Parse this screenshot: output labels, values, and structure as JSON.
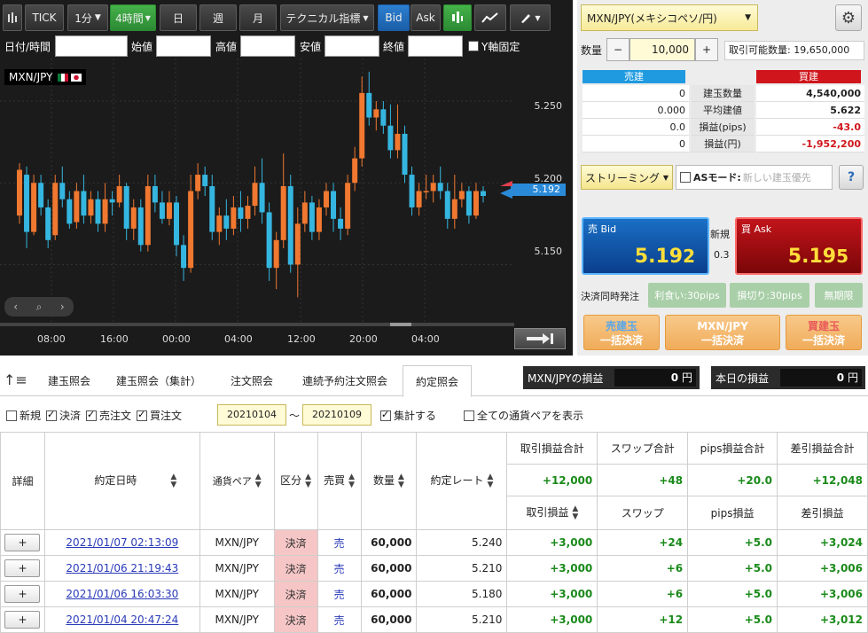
{
  "toolbar": {
    "tick": "TICK",
    "interval": "1分",
    "period": "4時間",
    "day": "日",
    "week": "週",
    "month": "月",
    "technical": "テクニカル指標",
    "bid": "Bid",
    "ask": "Ask"
  },
  "filter": {
    "datetime": "日付/時間",
    "open": "始値",
    "high": "高値",
    "low": "安値",
    "close": "終値",
    "yfix": "Y軸固定"
  },
  "chart": {
    "symbol": "MXN/JPY",
    "current_price": "5.192",
    "price_labels": [
      "5.250",
      "5.200",
      "5.150"
    ],
    "time_labels": [
      "08:00",
      "16:00",
      "00:00",
      "04:00",
      "12:00",
      "20:00",
      "04:00"
    ],
    "colors": {
      "up": "#f07830",
      "down": "#35b6e0",
      "bg": "#1b1b1b",
      "current": "#2a8ad8"
    }
  },
  "chart_data": {
    "type": "candlestick",
    "y_range": [
      5.115,
      5.275
    ],
    "candles": [
      [
        5.18,
        5.208,
        5.175,
        5.212
      ],
      [
        5.205,
        5.17,
        5.16,
        5.21
      ],
      [
        5.17,
        5.2,
        5.168,
        5.205
      ],
      [
        5.2,
        5.185,
        5.18,
        5.205
      ],
      [
        5.185,
        5.165,
        5.16,
        5.19
      ],
      [
        5.168,
        5.2,
        5.165,
        5.205
      ],
      [
        5.2,
        5.19,
        5.185,
        5.21
      ],
      [
        5.19,
        5.175,
        5.172,
        5.195
      ],
      [
        5.176,
        5.195,
        5.172,
        5.2
      ],
      [
        5.195,
        5.18,
        5.175,
        5.205
      ],
      [
        5.18,
        5.19,
        5.175,
        5.195
      ],
      [
        5.19,
        5.175,
        5.17,
        5.195
      ],
      [
        5.175,
        5.19,
        5.17,
        5.2
      ],
      [
        5.19,
        5.188,
        5.18,
        5.195
      ],
      [
        5.188,
        5.198,
        5.185,
        5.205
      ],
      [
        5.198,
        5.172,
        5.165,
        5.2
      ],
      [
        5.172,
        5.185,
        5.165,
        5.19
      ],
      [
        5.185,
        5.162,
        5.158,
        5.19
      ],
      [
        5.162,
        5.198,
        5.158,
        5.205
      ],
      [
        5.198,
        5.188,
        5.182,
        5.205
      ],
      [
        5.188,
        5.178,
        5.175,
        5.195
      ],
      [
        5.178,
        5.188,
        5.174,
        5.195
      ],
      [
        5.188,
        5.162,
        5.155,
        5.192
      ],
      [
        5.162,
        5.148,
        5.14,
        5.168
      ],
      [
        5.148,
        5.195,
        5.145,
        5.205
      ],
      [
        5.195,
        5.205,
        5.19,
        5.212
      ],
      [
        5.205,
        5.198,
        5.192,
        5.21
      ],
      [
        5.198,
        5.17,
        5.165,
        5.205
      ],
      [
        5.17,
        5.18,
        5.162,
        5.185
      ],
      [
        5.18,
        5.172,
        5.165,
        5.19
      ],
      [
        5.172,
        5.185,
        5.168,
        5.192
      ],
      [
        5.185,
        5.178,
        5.17,
        5.195
      ],
      [
        5.178,
        5.186,
        5.172,
        5.192
      ],
      [
        5.186,
        5.2,
        5.18,
        5.21
      ],
      [
        5.2,
        5.182,
        5.175,
        5.215
      ],
      [
        5.182,
        5.148,
        5.14,
        5.188
      ],
      [
        5.148,
        5.165,
        5.135,
        5.17
      ],
      [
        5.165,
        5.198,
        5.16,
        5.218
      ],
      [
        5.198,
        5.15,
        5.145,
        5.205
      ],
      [
        5.15,
        5.175,
        5.13,
        5.185
      ],
      [
        5.175,
        5.188,
        5.17,
        5.195
      ],
      [
        5.188,
        5.17,
        5.165,
        5.192
      ],
      [
        5.17,
        5.185,
        5.165,
        5.19
      ],
      [
        5.185,
        5.195,
        5.18,
        5.2
      ],
      [
        5.195,
        5.178,
        5.17,
        5.2
      ],
      [
        5.178,
        5.172,
        5.165,
        5.185
      ],
      [
        5.172,
        5.2,
        5.168,
        5.205
      ],
      [
        5.2,
        5.215,
        5.195,
        5.222
      ],
      [
        5.215,
        5.255,
        5.21,
        5.265
      ],
      [
        5.255,
        5.24,
        5.235,
        5.268
      ],
      [
        5.24,
        5.245,
        5.232,
        5.25
      ],
      [
        5.245,
        5.235,
        5.23,
        5.25
      ],
      [
        5.235,
        5.22,
        5.215,
        5.248
      ],
      [
        5.22,
        5.23,
        5.215,
        5.248
      ],
      [
        5.23,
        5.205,
        5.2,
        5.235
      ],
      [
        5.205,
        5.185,
        5.18,
        5.21
      ],
      [
        5.185,
        5.195,
        5.18,
        5.2
      ],
      [
        5.195,
        5.195,
        5.19,
        5.205
      ],
      [
        5.195,
        5.2,
        5.188,
        5.205
      ],
      [
        5.2,
        5.195,
        5.19,
        5.21
      ],
      [
        5.195,
        5.178,
        5.172,
        5.2
      ],
      [
        5.178,
        5.19,
        5.172,
        5.205
      ],
      [
        5.19,
        5.195,
        5.185,
        5.2
      ],
      [
        5.195,
        5.18,
        5.175,
        5.198
      ],
      [
        5.18,
        5.195,
        5.178,
        5.2
      ],
      [
        5.195,
        5.192,
        5.188,
        5.198
      ]
    ]
  },
  "trade": {
    "symbol": "MXN/JPY(メキシコペソ/円)",
    "qty_label": "数量",
    "qty": "10,000",
    "minus": "−",
    "plus": "+",
    "available_label": "取引可能数量:",
    "available": "19,650,000",
    "sell_header": "売建",
    "buy_header": "買建",
    "rows": [
      {
        "label": "建玉数量",
        "sell": "0",
        "buy": "4,540,000"
      },
      {
        "label": "平均建値",
        "sell": "0.000",
        "buy": "5.622"
      },
      {
        "label": "損益(pips)",
        "sell": "0.0",
        "buy": "-43.0"
      },
      {
        "label": "損益(円)",
        "sell": "0",
        "buy": "-1,952,200"
      }
    ],
    "streaming": "ストリーミング",
    "as_mode": "ASモード:",
    "as_placeholder": "新しい建玉優先",
    "help": "?",
    "sell_label": "売 Bid",
    "sell_big": "5.19",
    "sell_small": "2",
    "buy_label": "買 Ask",
    "buy_big": "5.19",
    "buy_small": "5",
    "new_label": "新規",
    "spread": "0.3",
    "settle_label": "決済同時発注",
    "take_profit": "利食い:30pips",
    "stop_loss": "損切り:30pips",
    "unlimited": "無期限",
    "btn_sell_all_1": "売建玉",
    "btn_sell_all_2": "一括決済",
    "btn_pair_all_1": "MXN/JPY",
    "btn_pair_all_2": "一括決済",
    "btn_buy_all_1": "買建玉",
    "btn_buy_all_2": "一括決済"
  },
  "tabs": [
    "建玉照会",
    "建玉照会（集計）",
    "注文照会",
    "連続予約注文照会",
    "約定照会"
  ],
  "pl_box": {
    "pair_label": "MXN/JPYの損益",
    "pair_value": "0",
    "today_label": "本日の損益",
    "today_value": "0",
    "unit": "円"
  },
  "filters": {
    "new": "新規",
    "settle": "決済",
    "sell": "売注文",
    "buy": "買注文",
    "from": "20210104",
    "tilde": "〜",
    "to": "20210109",
    "aggregate": "集計する",
    "all_pairs": "全ての通貨ペアを表示"
  },
  "table": {
    "headers": {
      "detail": "詳細",
      "datetime": "約定日時",
      "pair": "通貨ペア",
      "type": "区分",
      "side": "売買",
      "qty": "数量",
      "rate": "約定レート",
      "pl_total": "取引損益合計",
      "swap_total": "スワップ合計",
      "pips_total": "pips損益合計",
      "net_total": "差引損益合計",
      "pl": "取引損益",
      "swap": "スワップ",
      "pips": "pips損益",
      "net": "差引損益"
    },
    "totals": {
      "pl": "+12,000",
      "swap": "+48",
      "pips": "+20.0",
      "net": "+12,048"
    },
    "rows": [
      {
        "expand": "+",
        "datetime": "2021/01/07 02:13:09",
        "pair": "MXN/JPY",
        "type": "決済",
        "side": "売",
        "qty": "60,000",
        "rate": "5.240",
        "pl": "+3,000",
        "swap": "+24",
        "pips": "+5.0",
        "net": "+3,024"
      },
      {
        "expand": "+",
        "datetime": "2021/01/06 21:19:43",
        "pair": "MXN/JPY",
        "type": "決済",
        "side": "売",
        "qty": "60,000",
        "rate": "5.210",
        "pl": "+3,000",
        "swap": "+6",
        "pips": "+5.0",
        "net": "+3,006"
      },
      {
        "expand": "+",
        "datetime": "2021/01/06 16:03:30",
        "pair": "MXN/JPY",
        "type": "決済",
        "side": "売",
        "qty": "60,000",
        "rate": "5.180",
        "pl": "+3,000",
        "swap": "+6",
        "pips": "+5.0",
        "net": "+3,006"
      },
      {
        "expand": "+",
        "datetime": "2021/01/04 20:47:24",
        "pair": "MXN/JPY",
        "type": "決済",
        "side": "売",
        "qty": "60,000",
        "rate": "5.210",
        "pl": "+3,000",
        "swap": "+12",
        "pips": "+5.0",
        "net": "+3,012"
      }
    ]
  }
}
